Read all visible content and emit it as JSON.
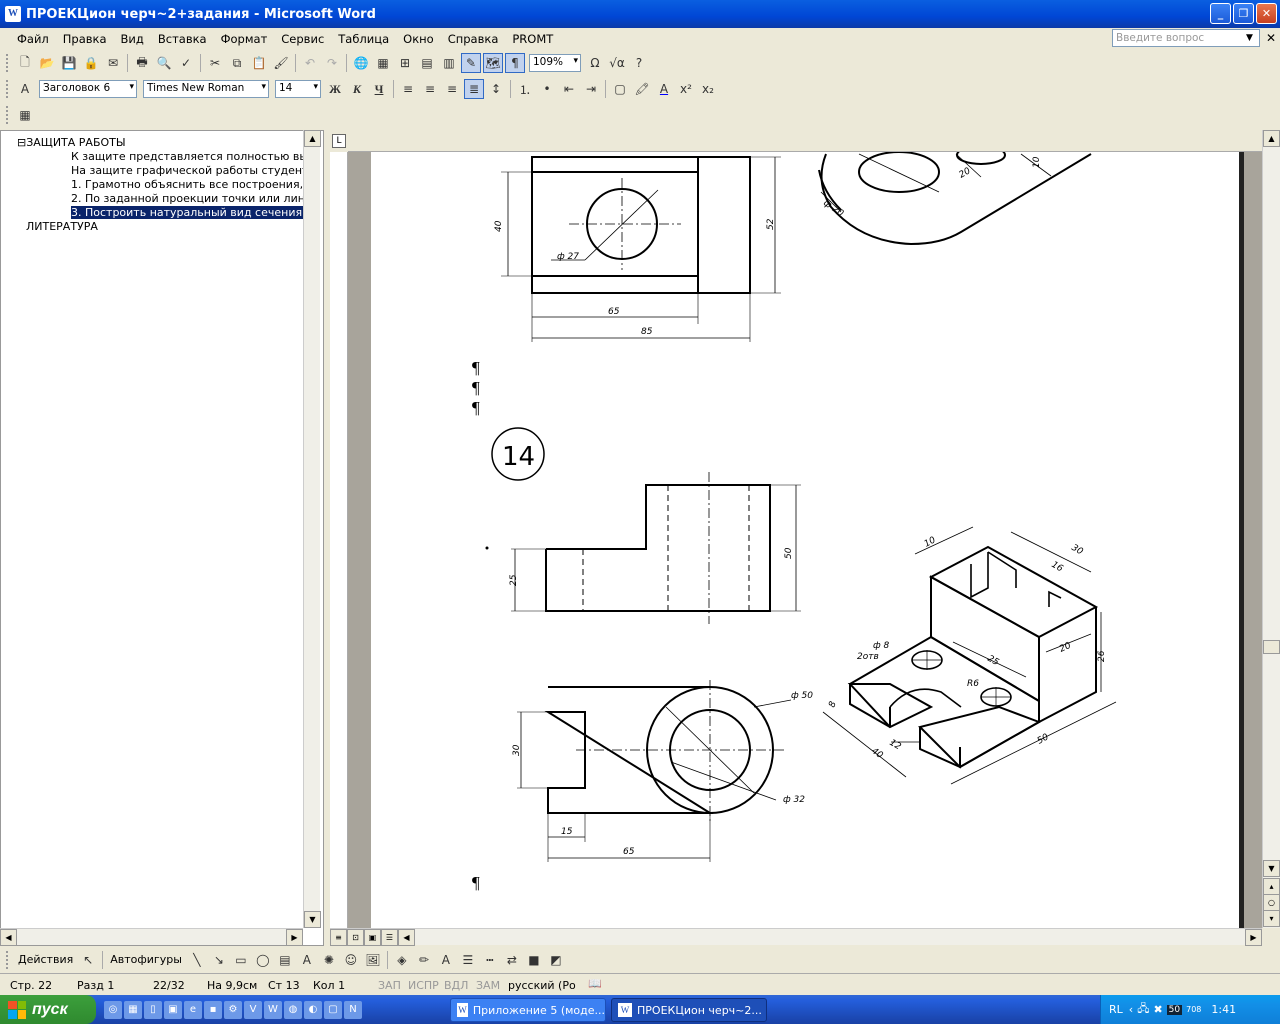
{
  "window": {
    "title": "ПРОЕКЦион черч~2+задания - Microsoft Word",
    "app_icon": "W"
  },
  "menu": {
    "items": [
      "Файл",
      "Правка",
      "Вид",
      "Вставка",
      "Формат",
      "Сервис",
      "Таблица",
      "Окно",
      "Справка",
      "PROMT"
    ],
    "help_placeholder": "Введите вопрос"
  },
  "standard_toolbar": {
    "zoom": "109%"
  },
  "format_toolbar": {
    "style": "Заголовок 6",
    "font": "Times New Roman",
    "size": "14",
    "bold": "Ж",
    "italic": "К",
    "underline": "Ч"
  },
  "document_map": {
    "lines": [
      "⊟ЗАЩИТА РАБОТЫ",
      "К защите представляется полностью вып",
      "На защите графической работы студент д",
      "1. Грамотно объяснить все построения, в",
      "2. По заданной проекции точки или лини",
      "3. Построить натуральный вид сечения д",
      "ЛИТЕРАТУРА"
    ],
    "selected_index": 5
  },
  "document": {
    "task_number": "14",
    "pilcrow": "¶",
    "dims_top": {
      "d40": "40",
      "d52": "52",
      "d65": "65",
      "d85": "85",
      "phi27": "ф 27",
      "phi20": "ф 20",
      "d20": "20",
      "d10": "10"
    },
    "dims_front": {
      "d25": "25",
      "d50": "50"
    },
    "dims_plan": {
      "d30": "30",
      "d15": "15",
      "d65": "65",
      "phi50": "ф 50",
      "phi32": "ф 32"
    },
    "dims_iso": {
      "d10": "10",
      "d30": "30",
      "d16": "16",
      "phi8": "ф 8",
      "holes": "2отв",
      "d25": "25",
      "d20": "20",
      "d26": "26",
      "r6": "R6",
      "d8": "8",
      "d12": "12",
      "d40": "40",
      "d50": "50"
    }
  },
  "drawing_toolbar": {
    "actions": "Действия",
    "autoshapes": "Автофигуры"
  },
  "status": {
    "page": "Стр. 22",
    "section": "Разд 1",
    "pages": "22/32",
    "at": "На 9,9см",
    "line": "Ст 13",
    "col": "Кол 1",
    "rec": "ЗАП",
    "trk": "ИСПР",
    "ext": "ВДЛ",
    "ovr": "ЗАМ",
    "language": "русский (Ро"
  },
  "taskbar": {
    "start": "пуск",
    "tasks": [
      "Приложение 5 (моде...",
      "ПРОЕКЦион черч~2..."
    ],
    "tray_lang": "RL",
    "tray_num": "50",
    "tray_small": "708",
    "clock": "1:41"
  }
}
